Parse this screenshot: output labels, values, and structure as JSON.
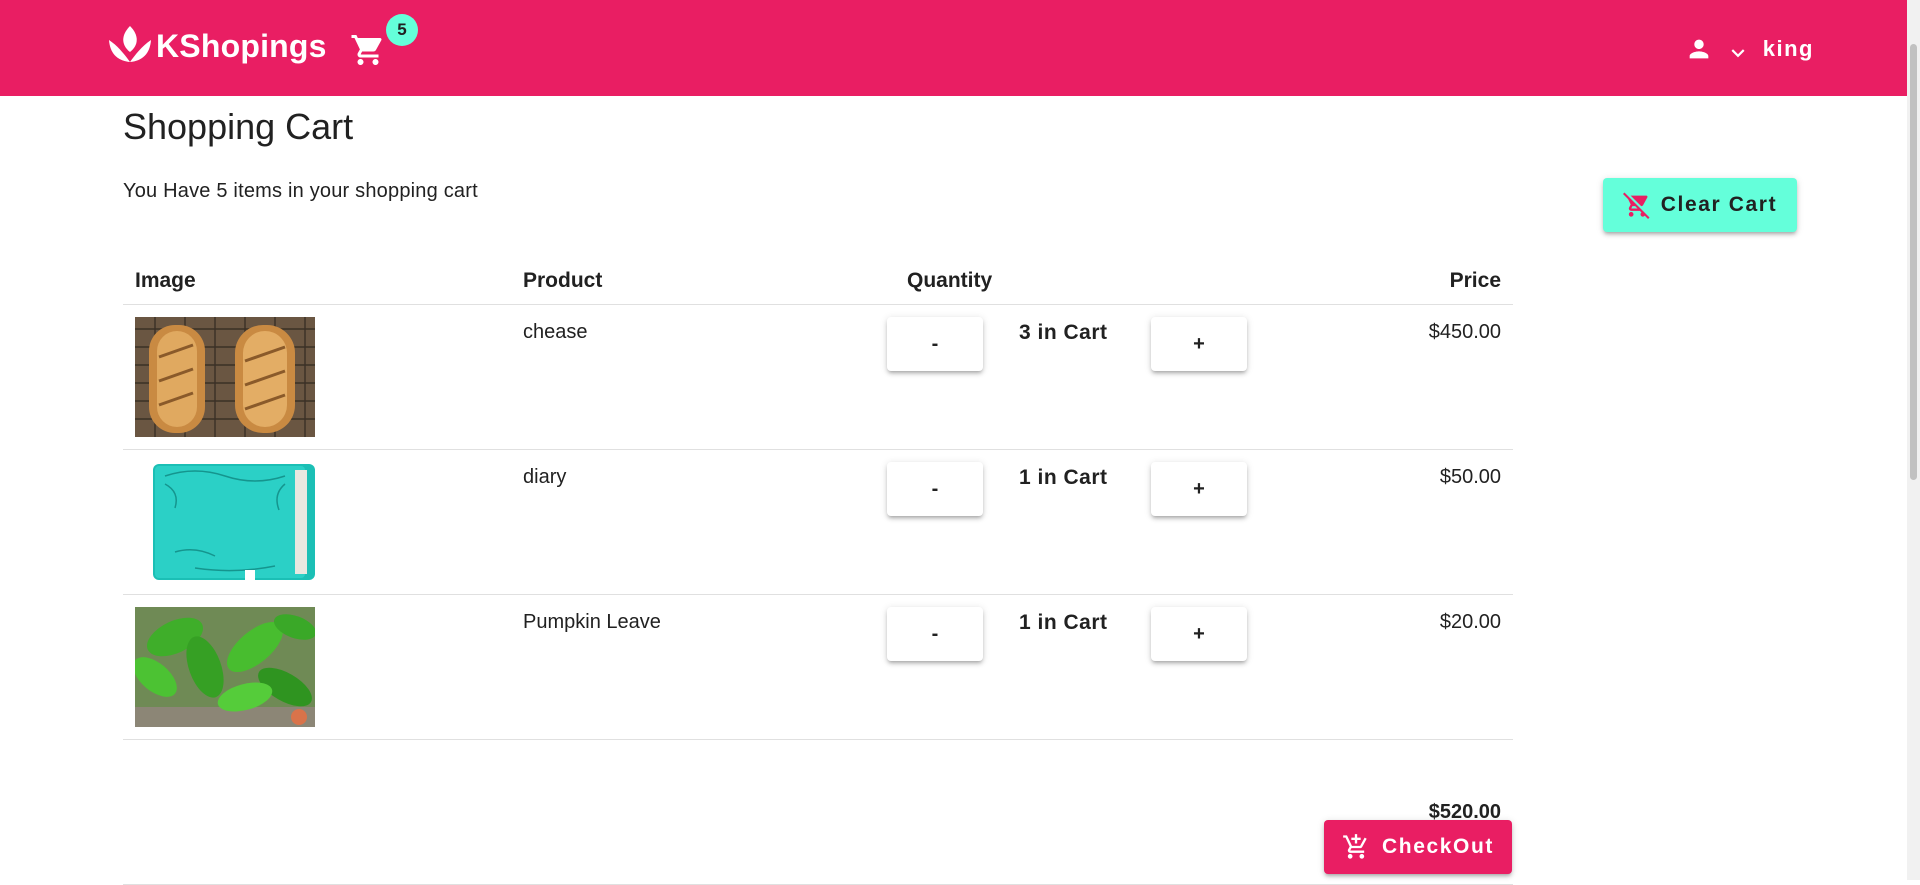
{
  "header": {
    "brand": "KShopings",
    "cart_count": "5",
    "username": "king",
    "colors": {
      "primary": "#e91e63",
      "accent": "#64ffda"
    },
    "icons": [
      "lotus-logo-icon",
      "cart-icon",
      "person-icon",
      "chevron-down-icon"
    ]
  },
  "page": {
    "title": "Shopping Cart",
    "summary": "You Have 5 items in your shopping cart",
    "clear_cart_label": "Clear Cart",
    "clear_cart_icon": "remove-shopping-cart-icon"
  },
  "table": {
    "columns": [
      "Image",
      "Product",
      "Quantity",
      "Price"
    ],
    "rows": [
      {
        "name": "chease",
        "quantity": "3 in Cart",
        "price": "$450.00",
        "image": "baguette-bread-image"
      },
      {
        "name": "diary",
        "quantity": "1 in Cart",
        "price": "$50.00",
        "image": "teal-diary-image"
      },
      {
        "name": "Pumpkin Leave",
        "quantity": "1 in Cart",
        "price": "$20.00",
        "image": "pumpkin-leaves-image"
      }
    ],
    "minus_label": "-",
    "plus_label": "+",
    "total": "$520.00"
  },
  "checkout": {
    "label": "CheckOut",
    "icon": "add-shopping-cart-icon"
  }
}
